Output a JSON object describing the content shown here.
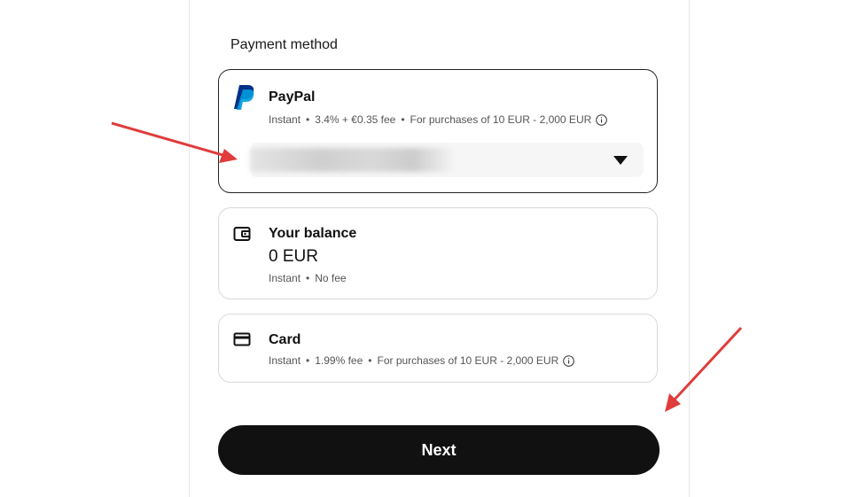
{
  "section_title": "Payment method",
  "methods": [
    {
      "id": "paypal",
      "title": "PayPal",
      "icon": "paypal-logo-icon",
      "selected": true,
      "speed": "Instant",
      "fee": "3.4% + €0.35 fee",
      "limits": "For purchases of 10 EUR - 2,000 EUR",
      "account_value": ""
    },
    {
      "id": "balance",
      "title": "Your balance",
      "icon": "wallet-icon",
      "selected": false,
      "amount": "0 EUR",
      "speed": "Instant",
      "fee": "No fee"
    },
    {
      "id": "card",
      "title": "Card",
      "icon": "credit-card-icon",
      "selected": false,
      "speed": "Instant",
      "fee": "1.99% fee",
      "limits": "For purchases of 10 EUR - 2,000 EUR"
    }
  ],
  "next_label": "Next",
  "colors": {
    "primary_button": "#111111",
    "annotation_arrow": "#e03c3c",
    "paypal_dark": "#003087",
    "paypal_light": "#009cde"
  }
}
